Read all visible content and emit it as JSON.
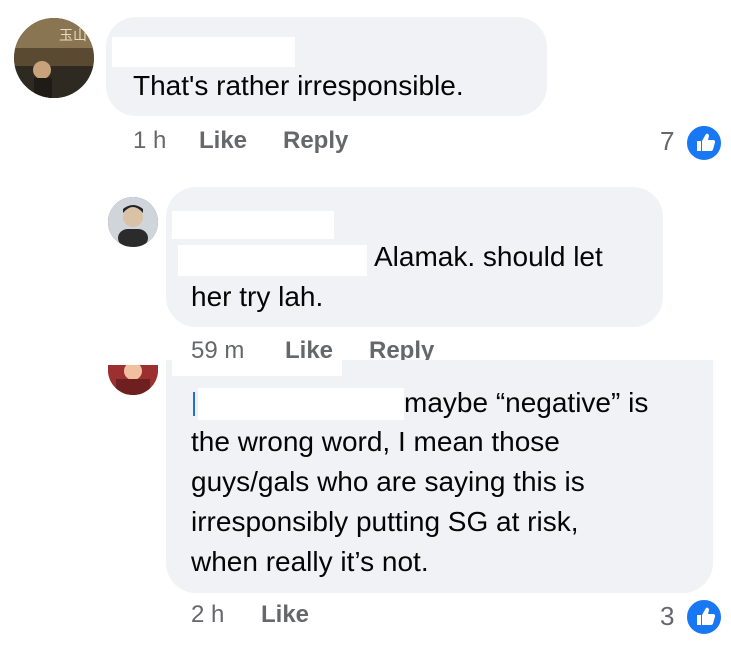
{
  "comments": [
    {
      "author_name": "",
      "text": "That's rather irresponsible.",
      "time": "1 h",
      "like_label": "Like",
      "reply_label": "Reply",
      "reactions_count": "7",
      "reaction_icon": "like-icon",
      "avatar_colors": {
        "bg": "#6d5a3e",
        "accent": "#c8b48a"
      }
    },
    {
      "author_name": "",
      "mention": "",
      "text_line1": "Alamak. should let",
      "text_line2": "her try lah.",
      "time": "59 m",
      "like_label": "Like",
      "reply_label": "Reply",
      "avatar_colors": {
        "bg": "#3a3a3a",
        "accent": "#d9c2a6"
      }
    },
    {
      "author_name": "",
      "mention": "",
      "lines": [
        "maybe “negative” is",
        "the wrong word, I mean those",
        "guys/gals who are saying this is",
        "irresponsibly putting SG at risk,",
        "when really it’s not."
      ],
      "time": "2 h",
      "like_label": "Like",
      "reactions_count": "3",
      "reaction_icon": "like-icon",
      "avatar_colors": {
        "bg": "#b23b3b",
        "accent": "#f0c0a0"
      }
    }
  ],
  "colors": {
    "bubble": "#f0f2f5",
    "meta": "#65676b",
    "link": "#216fdb",
    "like_blue": "#1877f2"
  }
}
